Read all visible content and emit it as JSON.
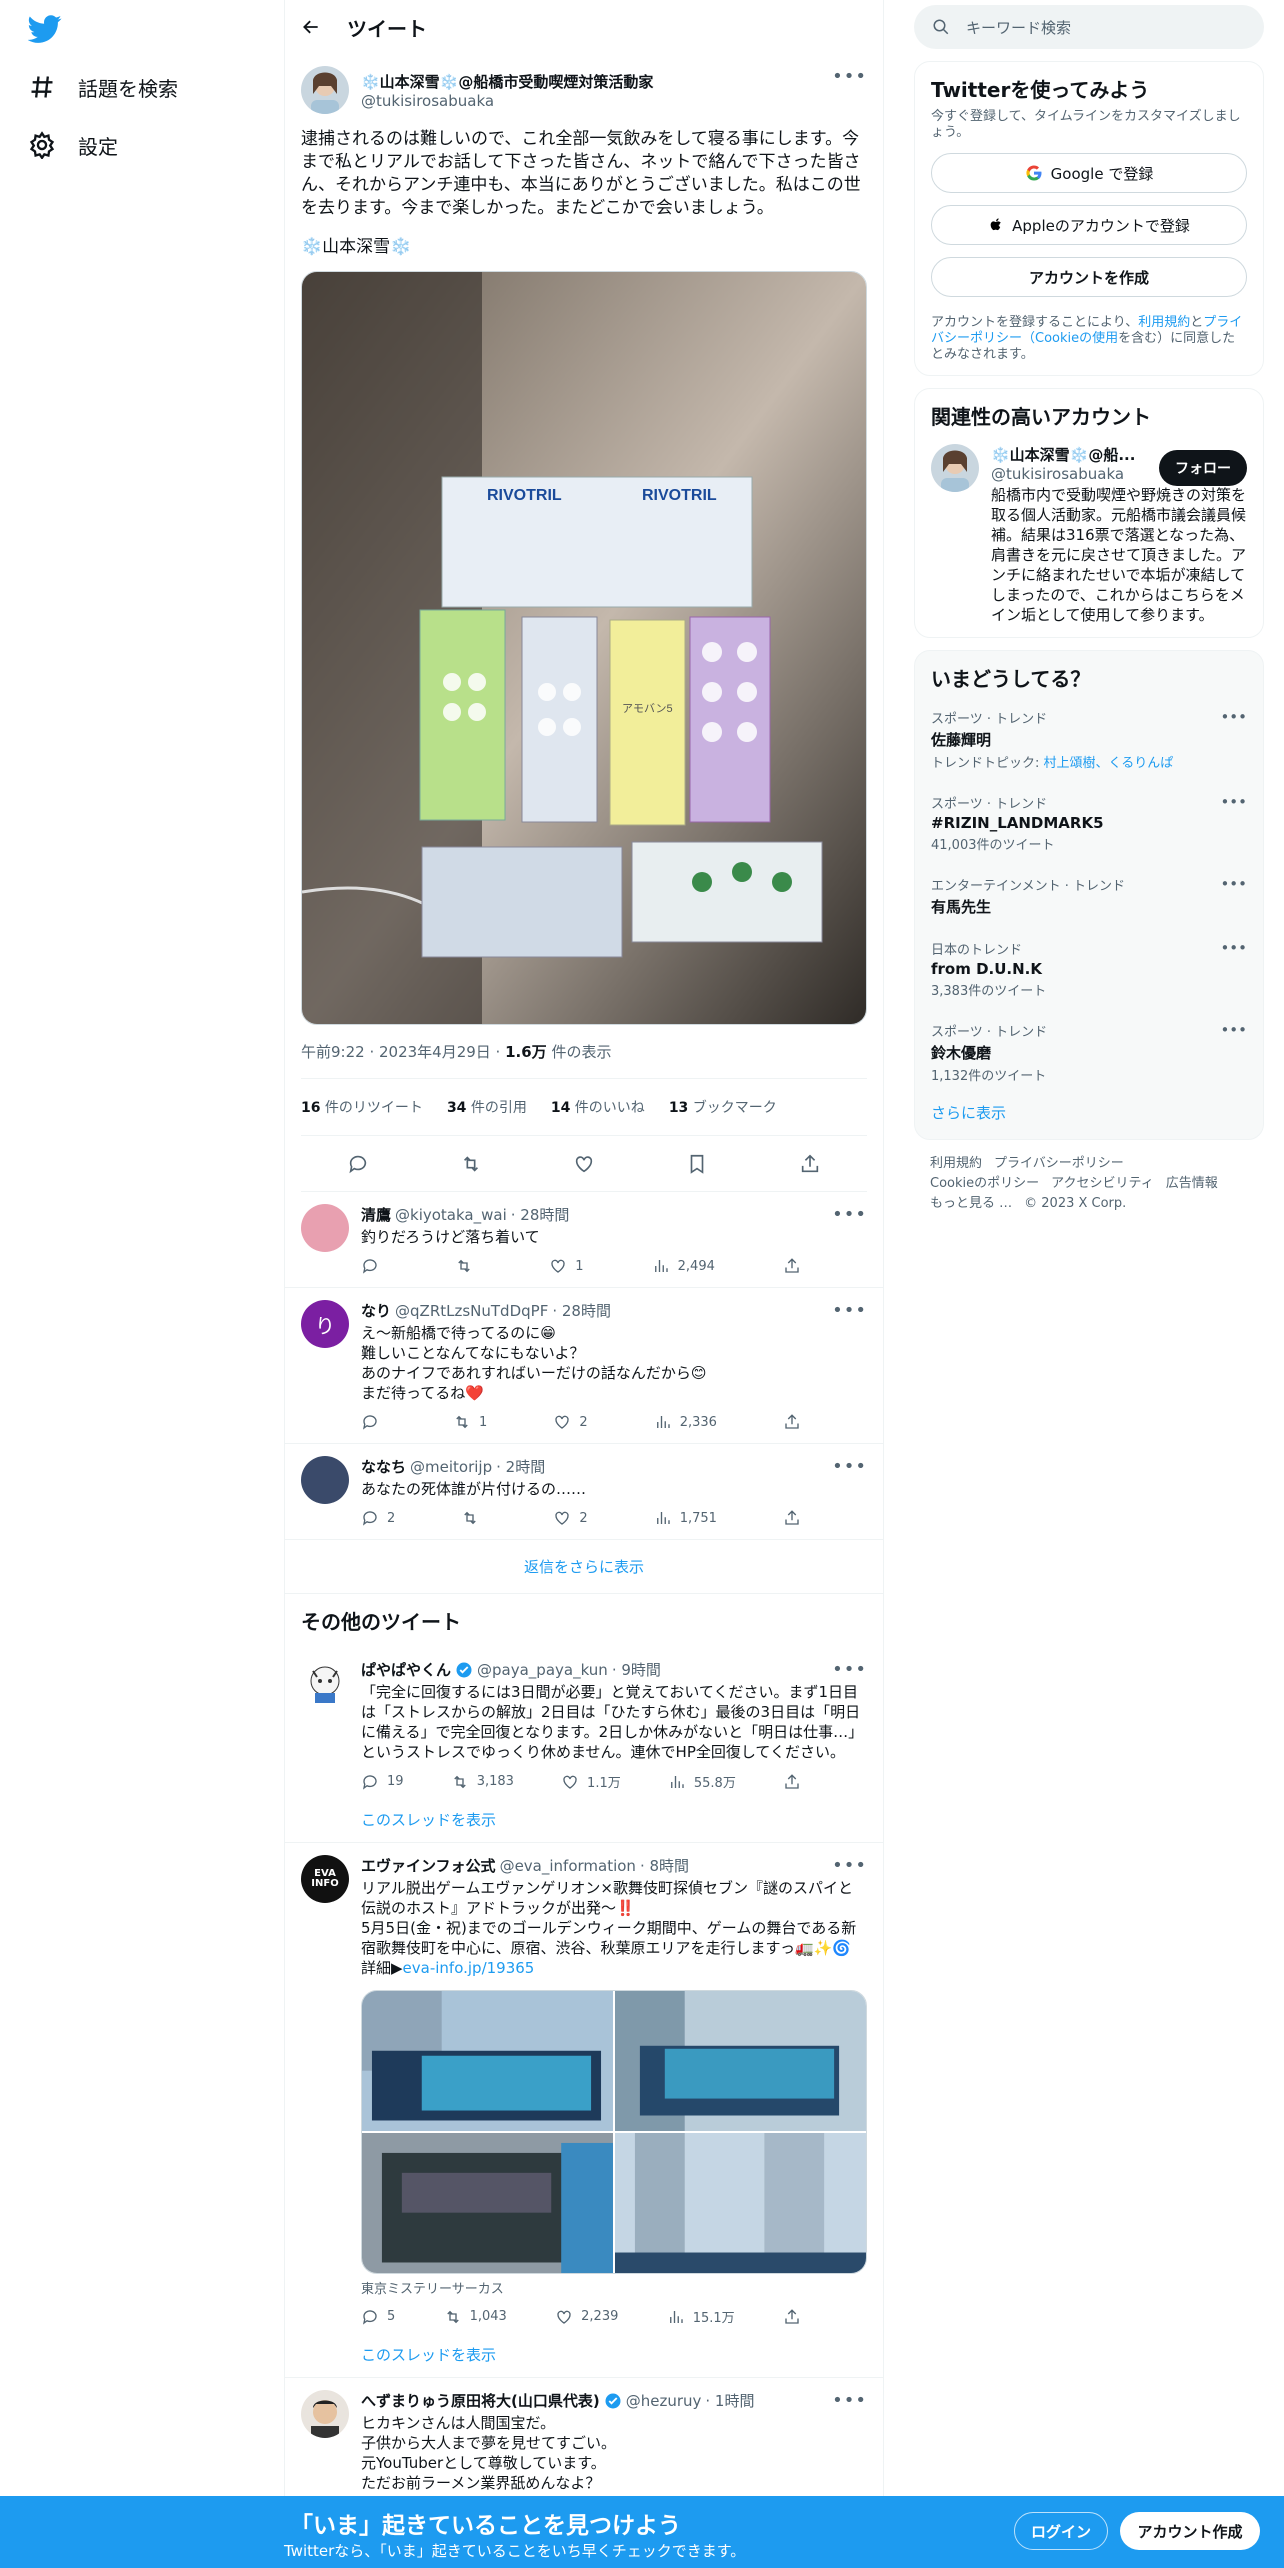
{
  "nav": {
    "explore": "話題を検索",
    "settings": "設定"
  },
  "header": {
    "title": "ツイート"
  },
  "tweet": {
    "name": "❄️山本深雪❄️@船橋市受動喫煙対策活動家",
    "handle": "@tukisirosabuaka",
    "text": "逮捕されるのは難しいので、これ全部一気飲みをして寝る事にします。今まで私とリアルでお話して下さった皆さん、ネットで絡んで下さった皆さん、それからアンチ連中も、本当にありがとうございました。私はこの世を去ります。今まで楽しかった。またどこかで会いましょう。",
    "signature": "❄️山本深雪❄️",
    "time": "午前9:22 · 2023年4月29日 · ",
    "views_count": "1.6万",
    "views_label": " 件の表示",
    "retweets_count": "16",
    "retweets_label": " 件のリツイート",
    "quotes_count": "34",
    "quotes_label": " 件の引用",
    "likes_count": "14",
    "likes_label": " 件のいいね",
    "bookmarks_count": "13",
    "bookmarks_label": " ブックマーク",
    "photo_texts": {
      "brand": "RIVOTRIL",
      "drug_label": "アモバン5"
    }
  },
  "replies": [
    {
      "name": "清鷹",
      "handle": "@kiyotaka_wai",
      "time": "· 28時間",
      "text": "釣りだろうけど落ち着いて",
      "reply": "",
      "retweet": "",
      "like": "1",
      "views": "2,494",
      "avatar_color": "#e8a0b0"
    },
    {
      "name": "なり",
      "handle": "@qZRtLzsNuTdDqPF",
      "time": "· 28時間",
      "text": "え～新船橋で待ってるのに😁\n難しいことなんてなにもないよ？\nあのナイフであれすればいーだけの話なんだから😊\nまだ待ってるね❤️",
      "reply": "",
      "retweet": "1",
      "like": "2",
      "views": "2,336",
      "avatar_color": "#7b1fa2",
      "avatar_letter": "り"
    },
    {
      "name": "ななち",
      "handle": "@meitorijp",
      "time": "· 2時間",
      "text": "あなたの死体誰が片付けるの……",
      "reply": "2",
      "retweet": "",
      "like": "2",
      "views": "1,751",
      "avatar_color": "#3a4a6a"
    }
  ],
  "more_replies": "返信をさらに表示",
  "other_section": "その他のツイート",
  "other": [
    {
      "name": "ぱやぱやくん",
      "handle": "@paya_paya_kun",
      "time": "· 9時間",
      "text": "「完全に回復するには3日間が必要」と覚えておいてください。まず1日目は「ストレスからの解放」2日目は「ひたすら休む」最後の3日目は「明日に備える」で完全回復となります。2日しか休みがないと「明日は仕事…」というストレスでゆっくり休めません。連休でHP全回復してください。",
      "reply": "19",
      "retweet": "3,183",
      "like": "1.1万",
      "views": "55.8万",
      "thread": "このスレッドを表示"
    },
    {
      "name": "エヴァインフォ公式",
      "handle": "@eva_information",
      "time": "· 8時間",
      "text": "リアル脱出ゲームエヴァンゲリオン×歌舞伎町探偵セブン『謎のスパイと伝説のホスト』アドトラックが出発～‼️\n5月5日(金・祝)までのゴールデンウィーク期間中、ゲームの舞台である新宿歌舞伎町を中心に、原宿、渋谷、秋葉原エリアを走行しますっ🚛✨🌀\n詳細▶",
      "link": "eva-info.jp/19365",
      "caption": "東京ミステリーサーカス",
      "reply": "5",
      "retweet": "1,043",
      "like": "2,239",
      "views": "15.1万",
      "thread": "このスレッドを表示",
      "avatar_text": "EVA INFO"
    },
    {
      "name": "へずまりゅう原田将大(山口県代表)",
      "handle": "@hezuruy",
      "time": "· 1時間",
      "text": "ヒカキンさんは人間国宝だ。\n子供から大人まで夢を見せてすごい。\n元YouTuberとして尊敬しています。\nただお前ラーメン業界舐めんなよ？"
    }
  ],
  "right": {
    "search_placeholder": "キーワード検索",
    "signup_title": "Twitterを使ってみよう",
    "signup_sub": "今すぐ登録して、タイムラインをカスタマイズしましょう。",
    "google": "Google で登録",
    "apple": "Appleのアカウントで登録",
    "create": "アカウントを作成",
    "legal_1": "アカウントを登録することにより、",
    "legal_terms": "利用規約",
    "legal_2": "と",
    "legal_privacy": "プライバシーポリシー（Cookieの使用",
    "legal_3": "を含む）に同意したとみなされます。",
    "related_title": "関連性の高いアカウント",
    "related_name": "❄️山本深雪❄️@船...",
    "related_handle": "@tukisirosabuaka",
    "related_bio": "船橋市内で受動喫煙や野焼きの対策を取る個人活動家。元船橋市議会議員候補。結果は316票で落選となった為、肩書きを元に戻させて頂きました。アンチに絡まれたせいで本垢が凍結してしまったので、これからはこちらをメイン垢として使用して参ります。",
    "follow": "フォロー",
    "trends_title": "いまどうしてる？",
    "trends": [
      {
        "cat": "スポーツ · トレンド",
        "name": "佐藤輝明",
        "count": "",
        "topic_label": "トレンドトピック: ",
        "topic": "村上頌樹、くるりんぱ"
      },
      {
        "cat": "スポーツ · トレンド",
        "name": "#RIZIN_LANDMARK5",
        "count": "41,003件のツイート"
      },
      {
        "cat": "エンターテインメント · トレンド",
        "name": "有馬先生",
        "count": ""
      },
      {
        "cat": "日本のトレンド",
        "name": "from D.U.N.K",
        "count": "3,383件のツイート"
      },
      {
        "cat": "スポーツ · トレンド",
        "name": "鈴木優磨",
        "count": "1,132件のツイート"
      }
    ],
    "show_more": "さらに表示",
    "footer": [
      "利用規約",
      "プライバシーポリシー",
      "Cookieのポリシー",
      "アクセシビリティ",
      "広告情報",
      "もっと見る …",
      "© 2023 X Corp."
    ]
  },
  "bottombar": {
    "title": "「いま」起きていることを見つけよう",
    "sub": "Twitterなら、「いま」起きていることをいち早くチェックできます。",
    "login": "ログイン",
    "signup": "アカウント作成"
  }
}
